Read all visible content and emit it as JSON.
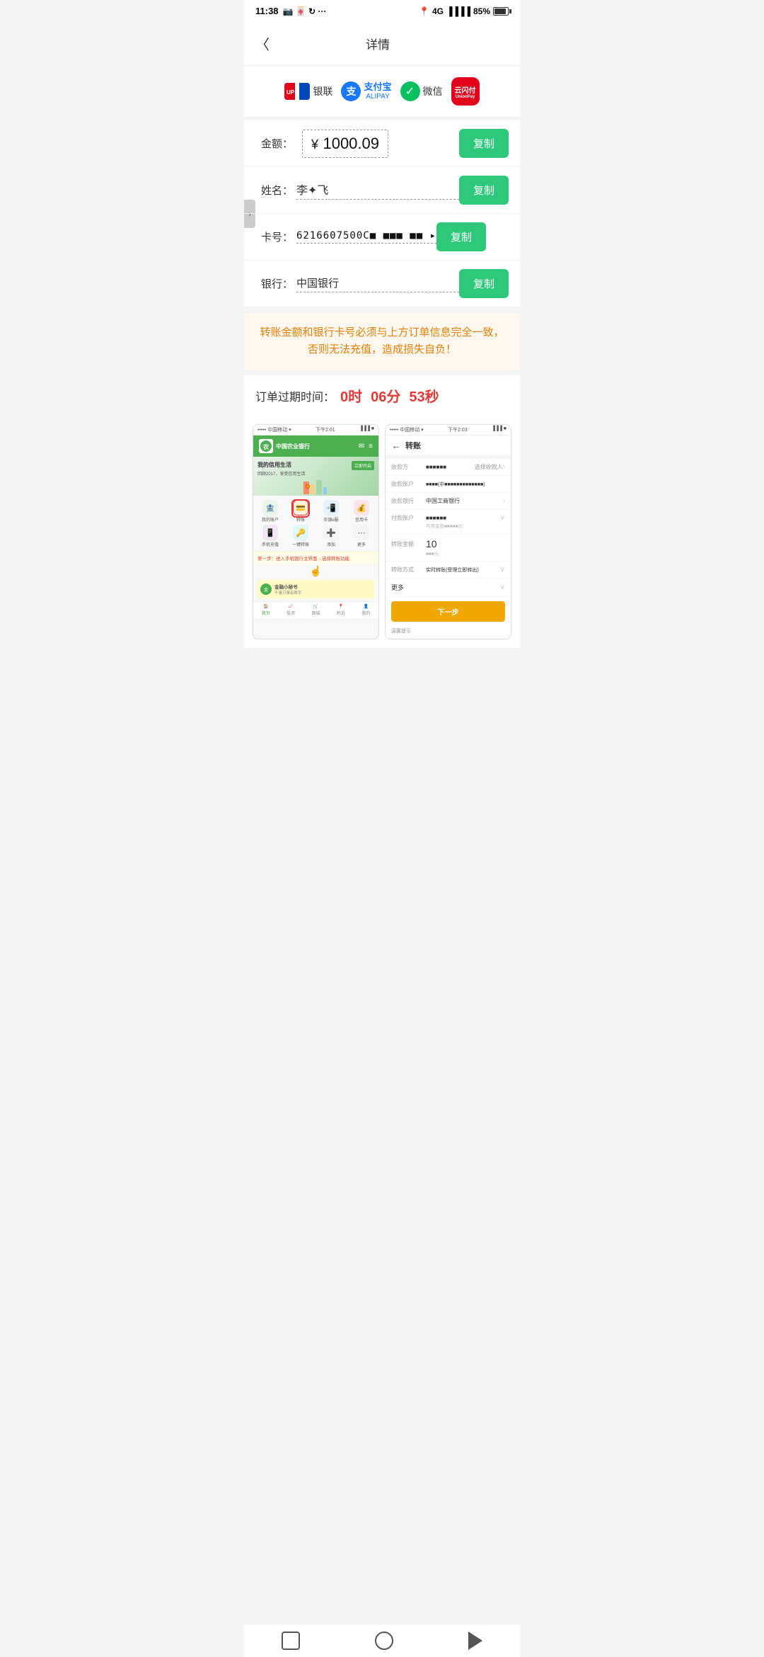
{
  "statusBar": {
    "time": "11:38",
    "battery": "85%",
    "signal": "4G"
  },
  "header": {
    "title": "详情",
    "backLabel": "<"
  },
  "paymentMethods": [
    {
      "id": "unionpay",
      "name": "银联",
      "label": "银联"
    },
    {
      "id": "alipay",
      "name": "支付宝",
      "label": "支付宝"
    },
    {
      "id": "wechat",
      "name": "微信",
      "label": "微信"
    },
    {
      "id": "yunshan",
      "name": "云闪付",
      "label": "云闪付"
    }
  ],
  "orderInfo": {
    "amountLabel": "金额：",
    "amountSymbol": "¥",
    "amountValue": "1000.09",
    "nameLabel": "姓名：",
    "nameValue": "李✦✦飞",
    "cardLabel": "卡号：",
    "cardValue": "6216607500C■ ■■■ ■■ ▸",
    "bankLabel": "银行：",
    "bankValue": "中国银行",
    "copyLabel": "复制"
  },
  "warning": {
    "text": "转账金额和银行卡号必须与上方订单信息完全一致，\n否则无法充值，造成损失自负！"
  },
  "timer": {
    "label": "订单过期时间：",
    "hours": "0时",
    "minutes": "06分",
    "seconds": "53秒"
  },
  "tutorial": {
    "step1": "第一步：进入手机银行主界面→选择转账功能",
    "bulletLabel": "● 金融小秘书",
    "abcBankName": "中国农业银行",
    "abcSlogan": "我的信用生活",
    "abcSloganSub": "回顾2017，享受信用生活",
    "gridItems": [
      {
        "icon": "🏦",
        "label": "我的账户"
      },
      {
        "icon": "💳",
        "label": "转账"
      },
      {
        "icon": "📲",
        "label": "农银e服"
      },
      {
        "icon": "💰",
        "label": "信用卡"
      },
      {
        "icon": "📱",
        "label": "手机充值"
      },
      {
        "icon": "🔑",
        "label": "一键转账"
      },
      {
        "icon": "➕",
        "label": "添加"
      },
      {
        "icon": "⋯",
        "label": "更多"
      }
    ],
    "navItems": [
      "首页",
      "投资",
      "商城",
      "附近",
      "我的"
    ],
    "transferTitle": "转账",
    "transferFields": [
      {
        "label": "收款方",
        "value": "■■■■■■",
        "hasArrow": true,
        "hint": "选择收款人"
      },
      {
        "label": "收款账户",
        "value": "■■■■■■■■■(中国■■■■■■■■■■■■■)",
        "hasArrow": false
      },
      {
        "label": "收款银行",
        "value": "中国工商银行",
        "hasArrow": true
      },
      {
        "label": "付款账户",
        "value": "■■■■■■",
        "hasArrow": true,
        "hint": "可用金额■■■■■元"
      },
      {
        "label": "转账金额",
        "value": "10",
        "hint": "■■■元"
      },
      {
        "label": "转账方式",
        "value": "实时转账(受理立即转出)",
        "hasArrow": true
      },
      {
        "label": "更多",
        "value": "",
        "hasArrow": true
      },
      {
        "label": "",
        "value": "下一步",
        "isBtn": true
      },
      {
        "label": "温馨提示",
        "value": "",
        "isTip": true
      }
    ]
  },
  "bottomNav": {
    "items": [
      "square",
      "circle",
      "back"
    ]
  }
}
